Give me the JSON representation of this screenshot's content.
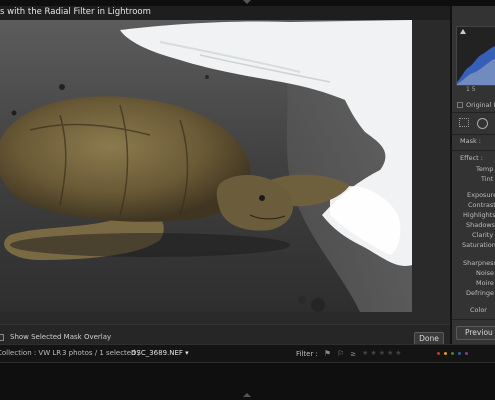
{
  "window": {
    "title": "s with the Radial Filter in Lightroom"
  },
  "photo_area": {
    "mask_overlay_label": "Show Selected Mask Overlay",
    "done_label": "Done"
  },
  "right_panel": {
    "histogram_value": "1 5",
    "original_label": "Original P",
    "mask_label": "Mask :",
    "effect_label": "Effect :",
    "sliders": [
      "Temp",
      "Tint",
      "Exposure",
      "Contrast",
      "Highlights",
      "Shadows",
      "Clarity",
      "Saturation",
      "Sharpness",
      "Noise",
      "Moire",
      "Defringe",
      "Color"
    ],
    "previous_label": "Previou"
  },
  "filmstrip": {
    "collection": "Collection : VW LR",
    "photo_count": "3 photos / 1 selected /",
    "filename": "DSC_3689.NEF",
    "filter_label": "Filter :",
    "stars_prefix": "≥",
    "star_count": 5,
    "color_dots": [
      "#c0392b",
      "#d4a017",
      "#3a8a3a",
      "#2e5fa3",
      "#7d3c98"
    ]
  }
}
